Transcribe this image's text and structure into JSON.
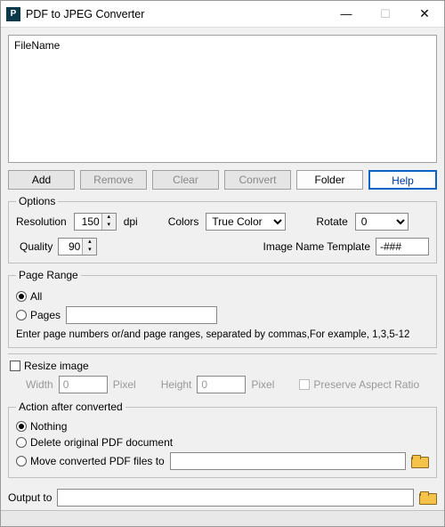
{
  "window": {
    "title": "PDF to JPEG Converter"
  },
  "filelist": {
    "header": "FileName"
  },
  "buttons": {
    "add": "Add",
    "remove": "Remove",
    "clear": "Clear",
    "convert": "Convert",
    "folder": "Folder",
    "help": "Help"
  },
  "options": {
    "legend": "Options",
    "resolution_label": "Resolution",
    "resolution_value": "150",
    "resolution_unit": "dpi",
    "colors_label": "Colors",
    "colors_value": "True Color",
    "rotate_label": "Rotate",
    "rotate_value": "0",
    "quality_label": "Quality",
    "quality_value": "90",
    "template_label": "Image Name Template",
    "template_value": "-###"
  },
  "pagerange": {
    "legend": "Page Range",
    "all": "All",
    "pages": "Pages",
    "pages_value": "",
    "hint": "Enter page numbers or/and page ranges, separated by commas,For example, 1,3,5-12"
  },
  "resize": {
    "label": "Resize image",
    "width_label": "Width",
    "width_value": "0",
    "height_label": "Height",
    "height_value": "0",
    "pixel": "Pixel",
    "preserve": "Preserve Aspect Ratio"
  },
  "action": {
    "legend": "Action after converted",
    "nothing": "Nothing",
    "delete": "Delete original PDF document",
    "move": "Move converted PDF files to",
    "move_path": ""
  },
  "output": {
    "label": "Output to",
    "value": ""
  }
}
